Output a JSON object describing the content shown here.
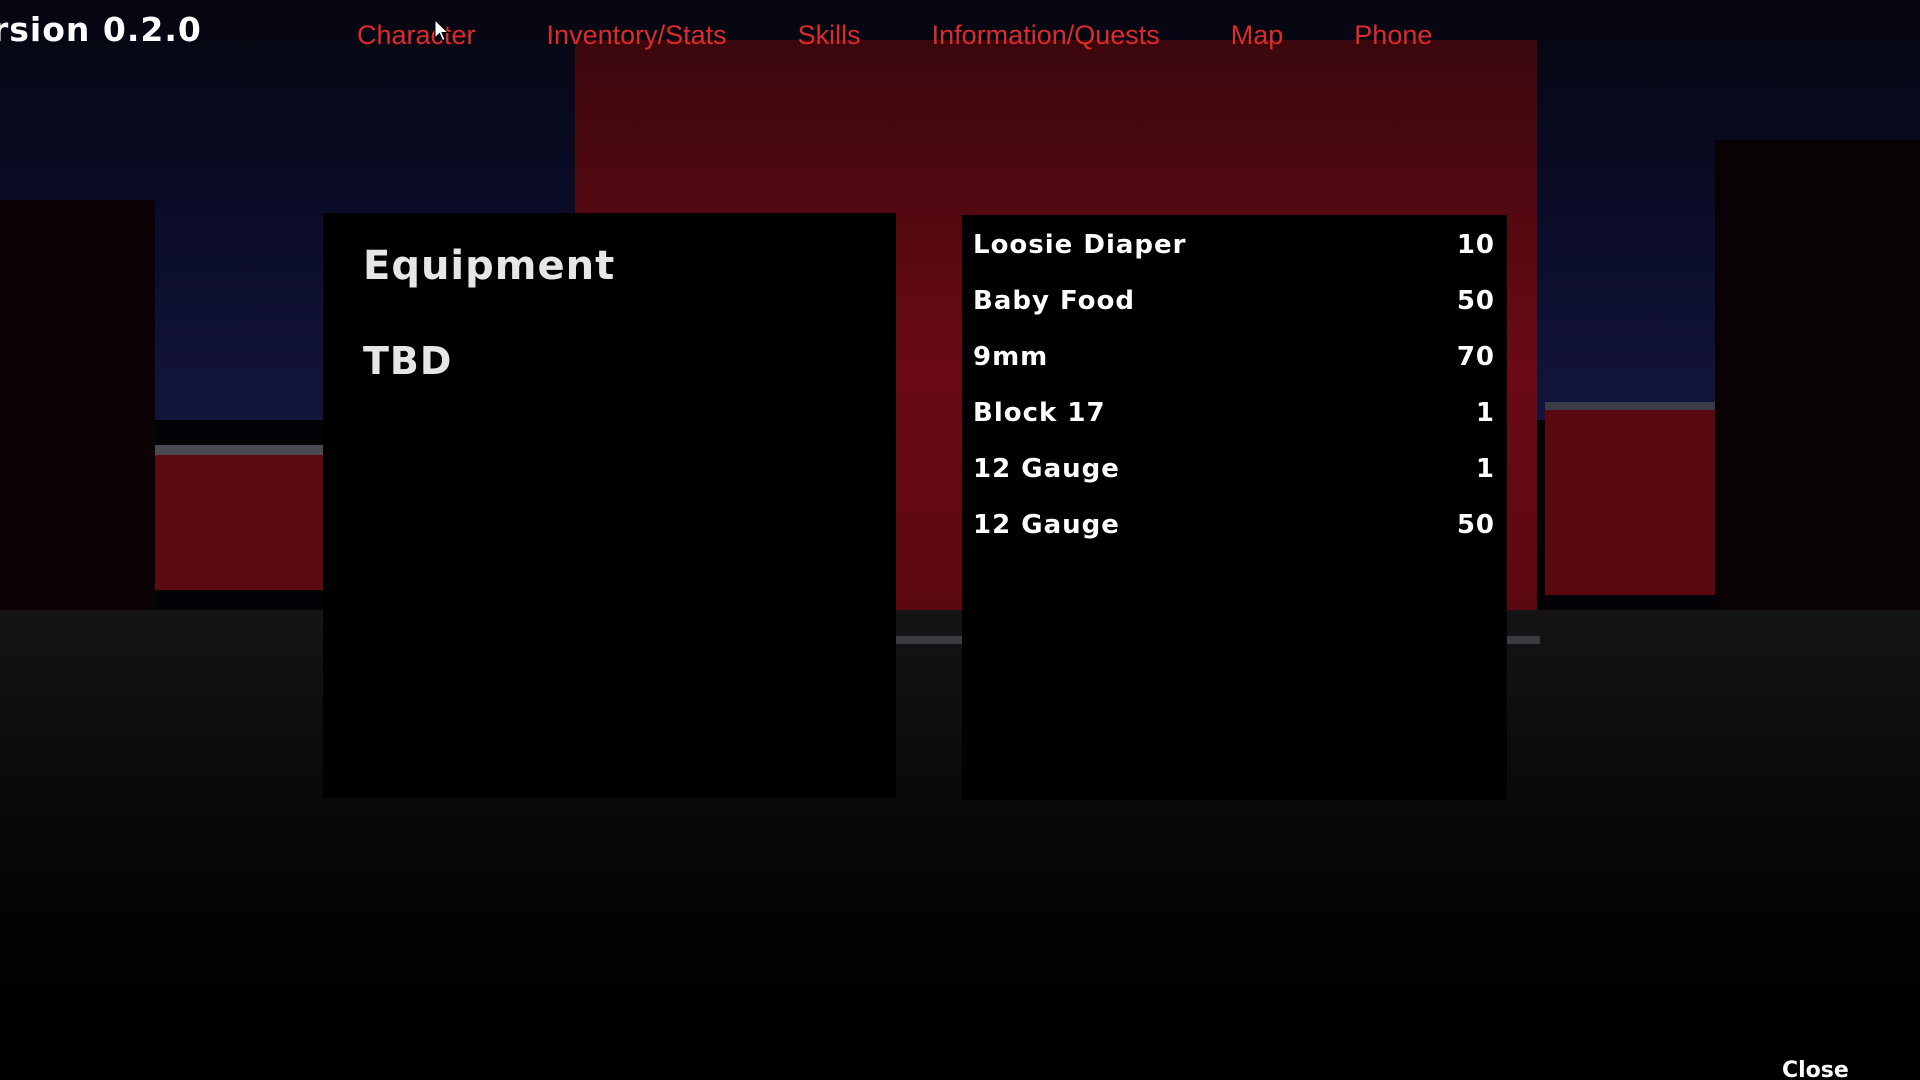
{
  "hud": {
    "version": "rsion 0.2.0"
  },
  "nav": {
    "tabs": [
      {
        "label": "Character"
      },
      {
        "label": "Inventory/Stats"
      },
      {
        "label": "Skills"
      },
      {
        "label": "Information/Quests"
      },
      {
        "label": "Map"
      },
      {
        "label": "Phone"
      }
    ]
  },
  "equipment": {
    "title": "Equipment",
    "content": "TBD"
  },
  "inventory": {
    "items": [
      {
        "name": "Loosie Diaper",
        "qty": "10"
      },
      {
        "name": "Baby Food",
        "qty": "50"
      },
      {
        "name": "9mm",
        "qty": "70"
      },
      {
        "name": "Block 17",
        "qty": "1"
      },
      {
        "name": "12 Gauge",
        "qty": "1"
      },
      {
        "name": "12 Gauge",
        "qty": "50"
      }
    ]
  },
  "footer": {
    "close_label": "Close"
  },
  "colors": {
    "tab_text": "#e02a2a",
    "panel_bg": "#000000",
    "text": "#ffffff"
  },
  "icons": {
    "cursor": "mouse-pointer-icon"
  }
}
